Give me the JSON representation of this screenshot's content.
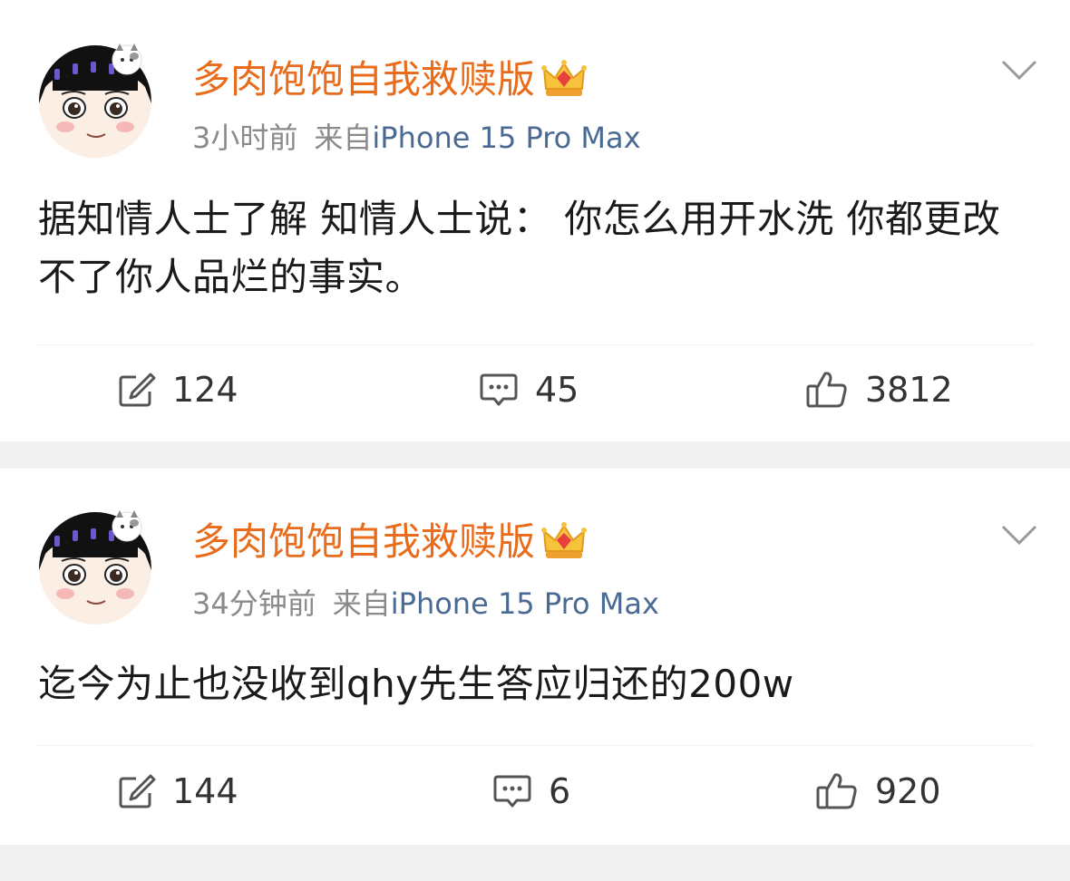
{
  "posts": [
    {
      "username": "多肉饱饱自我救赎版",
      "time": "3小时前",
      "source_prefix": "来自",
      "source_device": "iPhone 15 Pro Max",
      "content": "据知情人士了解 知情人士说： 你怎么用开水洗 你都更改不了你人品烂的事实。",
      "repost_count": "124",
      "comment_count": "45",
      "like_count": "3812"
    },
    {
      "username": "多肉饱饱自我救赎版",
      "time": "34分钟前",
      "source_prefix": "来自",
      "source_device": "iPhone 15 Pro Max",
      "content": "迄今为止也没收到qhy先生答应归还的200w",
      "repost_count": "144",
      "comment_count": "6",
      "like_count": "920"
    }
  ],
  "colors": {
    "username": "#e86c1b",
    "source": "#4a6a94",
    "meta": "#8a8a8a",
    "divider": "#f1f1f1"
  },
  "icons": {
    "badge": "crown-icon",
    "menu": "chevron-down-icon",
    "repost": "repost-icon",
    "comment": "comment-icon",
    "like": "thumbs-up-icon"
  }
}
